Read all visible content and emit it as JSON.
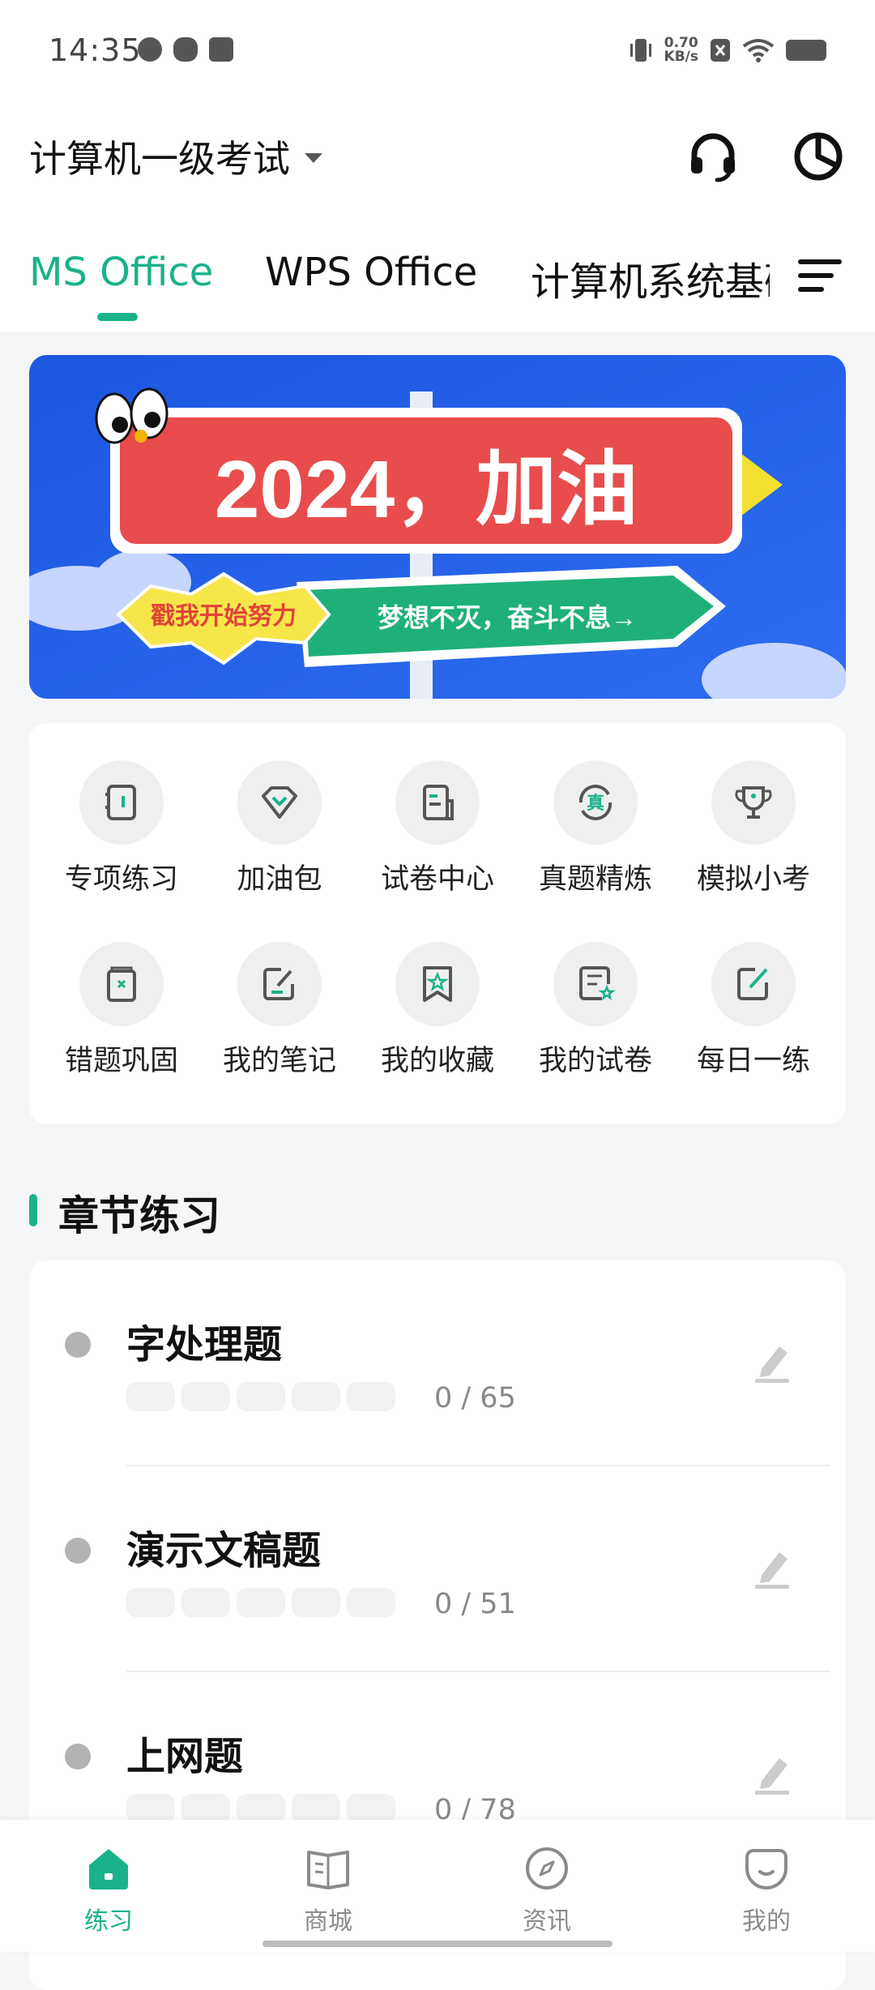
{
  "status_bar": {
    "time": "14:35",
    "net_speed_value": "0.70",
    "net_speed_unit": "KB/s"
  },
  "header": {
    "exam_title": "计算机一级考试",
    "support_icon": "headset-icon",
    "stats_icon": "pie-chart-icon"
  },
  "tabs": [
    {
      "label": "MS Office",
      "active": true
    },
    {
      "label": "WPS Office",
      "active": false
    },
    {
      "label": "计算机系统基础",
      "active": false
    }
  ],
  "banner": {
    "headline": "2024，加油",
    "tag": "戳我开始努力",
    "slogan": "梦想不灭，奋斗不息→"
  },
  "features": [
    {
      "label": "专项练习",
      "icon": "notebook-icon"
    },
    {
      "label": "加油包",
      "icon": "gem-icon"
    },
    {
      "label": "试卷中心",
      "icon": "exam-paper-icon"
    },
    {
      "label": "真题精炼",
      "icon": "real-exam-icon",
      "glyph": "真"
    },
    {
      "label": "模拟小考",
      "icon": "trophy-icon"
    },
    {
      "label": "错题巩固",
      "icon": "wrong-question-icon"
    },
    {
      "label": "我的笔记",
      "icon": "note-edit-icon"
    },
    {
      "label": "我的收藏",
      "icon": "star-bookmark-icon"
    },
    {
      "label": "我的试卷",
      "icon": "my-paper-icon"
    },
    {
      "label": "每日一练",
      "icon": "daily-edit-icon"
    }
  ],
  "section": {
    "title": "章节练习"
  },
  "chapters": [
    {
      "name": "字处理题",
      "count": "0 / 65",
      "progress": 0
    },
    {
      "name": "演示文稿题",
      "count": "0 / 51",
      "progress": 0
    },
    {
      "name": "上网题",
      "count": "0 / 78",
      "progress": 0
    }
  ],
  "bottom_nav": [
    {
      "label": "练习",
      "icon": "home-icon",
      "active": true
    },
    {
      "label": "商城",
      "icon": "book-icon",
      "active": false
    },
    {
      "label": "资讯",
      "icon": "compass-icon",
      "active": false
    },
    {
      "label": "我的",
      "icon": "profile-icon",
      "active": false
    }
  ],
  "colors": {
    "accent": "#1ab28b",
    "banner_bg": "#1e5fe0",
    "sign_red": "#e04a4a",
    "sign_green": "#1fb07a",
    "icon_gray": "#555555"
  }
}
